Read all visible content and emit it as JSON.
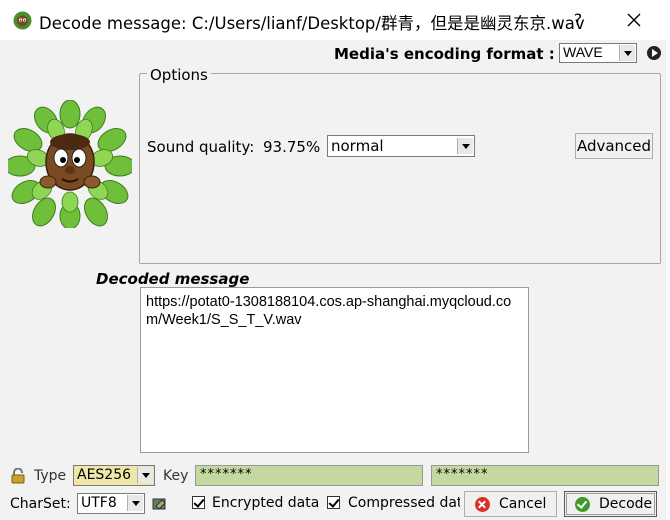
{
  "window": {
    "title": "Decode message: C:/Users/lianf/Desktop/群青，但是是幽灵东京.wav",
    "help_label": "?"
  },
  "media": {
    "label": "Media's encoding format :",
    "format": "WAVE"
  },
  "options": {
    "legend": "Options",
    "sound_quality_label": "Sound quality:",
    "sound_quality_value": "93.75%",
    "quality_mode": "normal",
    "advanced_label": "Advanced"
  },
  "decoded": {
    "label": "Decoded message",
    "text": "https://potat0-1308188104.cos.ap-shanghai.myqcloud.com/Week1/S_S_T_V.wav"
  },
  "encryption": {
    "type_label": "Type",
    "type_value": "AES256",
    "key_label": "Key",
    "key_value": "*******",
    "key_confirm_value": "*******"
  },
  "bottom": {
    "charset_label": "CharSet:",
    "charset_value": "UTF8",
    "encrypted_label": "Encrypted data",
    "encrypted_checked": true,
    "compressed_label": "Compressed data",
    "compressed_checked": true,
    "cancel_label": "Cancel",
    "decode_label": "Decode"
  },
  "icons": {
    "app": "mascot-icon",
    "lock": "lock-icon",
    "charset": "charset-icon",
    "play": "play-icon"
  }
}
